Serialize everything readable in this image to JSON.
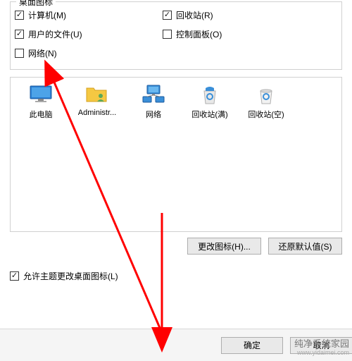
{
  "fieldset": {
    "legend": "桌面图标",
    "checkboxes": {
      "computer": {
        "label": "计算机(M)",
        "checked": true
      },
      "recycle": {
        "label": "回收站(R)",
        "checked": true
      },
      "userFiles": {
        "label": "用户的文件(U)",
        "checked": true
      },
      "controlPanel": {
        "label": "控制面板(O)",
        "checked": false
      },
      "network": {
        "label": "网络(N)",
        "checked": false
      }
    }
  },
  "iconList": {
    "thisPC": "此电脑",
    "admin": "Administr...",
    "network": "网络",
    "recycleFull": "回收站(满)",
    "recycleEmpty": "回收站(空)"
  },
  "buttons": {
    "changeIcon": "更改图标(H)...",
    "restoreDefault": "还原默认值(S)",
    "ok": "确定",
    "cancel": "取消"
  },
  "allowTheme": {
    "label": "允许主题更改桌面图标(L)",
    "checked": true
  },
  "watermark": {
    "line1": "纯净系统家园",
    "line2": "www.yidaimei.com"
  }
}
